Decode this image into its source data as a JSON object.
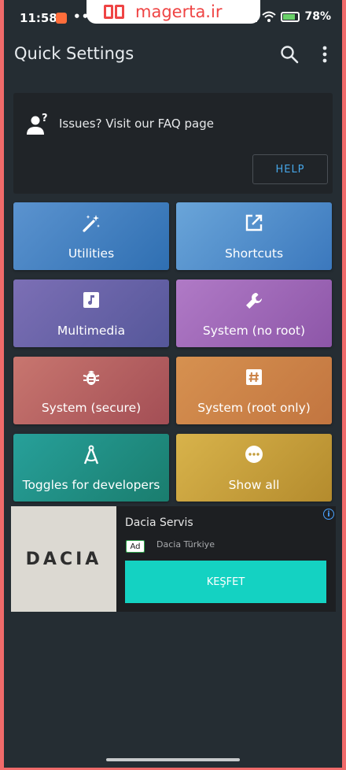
{
  "status_bar": {
    "time": "11:58",
    "more_indicator": "•••",
    "battery_percent": "78%",
    "icons": [
      "notification-icon",
      "signal-icon",
      "wifi-icon",
      "battery-icon"
    ]
  },
  "watermark": {
    "text": "magerta.ir"
  },
  "app_bar": {
    "title": "Quick Settings",
    "icons": [
      "search-icon",
      "more-vert-icon"
    ]
  },
  "faq_card": {
    "text": "Issues? Visit our FAQ page",
    "button_label": "HELP",
    "icon": "help-person-icon"
  },
  "tiles": [
    {
      "label": "Utilities",
      "icon": "magic-wand-icon"
    },
    {
      "label": "Shortcuts",
      "icon": "open-in-new-icon"
    },
    {
      "label": "Multimedia",
      "icon": "music-note-icon"
    },
    {
      "label": "System (no root)",
      "icon": "wrench-icon"
    },
    {
      "label": "System (secure)",
      "icon": "bug-icon"
    },
    {
      "label": "System (root only)",
      "icon": "hash-icon"
    },
    {
      "label": "Toggles for developers",
      "icon": "compass-icon"
    },
    {
      "label": "Show all",
      "icon": "more-horiz-icon"
    }
  ],
  "ad": {
    "image_text": "DACIA",
    "title": "Dacia Servis",
    "badge": "Ad",
    "advertiser": "Dacia Türkiye",
    "cta": "KEŞFET",
    "info": "i"
  },
  "colors": {
    "background": "#252d33",
    "accent": "#46a6e8",
    "cta": "#14d2c2",
    "frame": "#f06a6a"
  }
}
